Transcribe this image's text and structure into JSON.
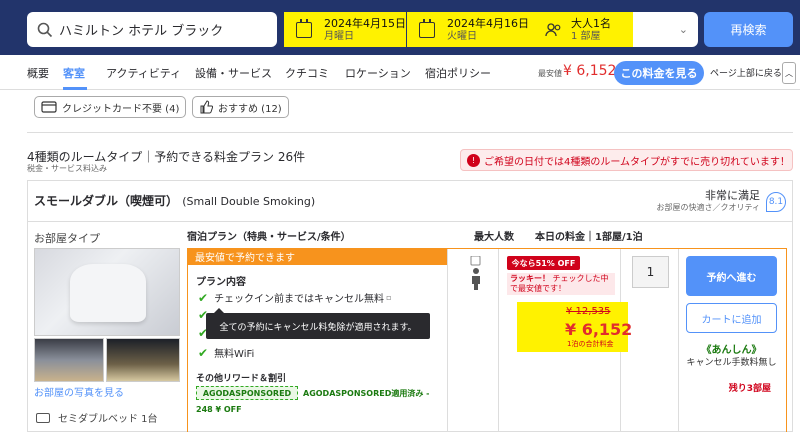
{
  "header": {
    "search_value": "ハミルトン ホテル ブラック",
    "checkin_date": "2024年4月15日",
    "checkin_day": "月曜日",
    "checkout_date": "2024年4月16日",
    "checkout_day": "火曜日",
    "guests": "大人1名",
    "rooms": "1 部屋",
    "research_label": "再検索"
  },
  "nav": {
    "tabs": [
      "概要",
      "客室",
      "アクティビティ",
      "設備・サービス",
      "クチコミ",
      "ロケーション",
      "宿泊ポリシー"
    ],
    "min_price_label": "最安値",
    "min_price": "¥ 6,152",
    "see_price_label": "この料金を見る",
    "to_top_label": "ページ上部に戻る"
  },
  "filters": {
    "chips": [
      "クレジットカード不要 (4)",
      "おすすめ (12)"
    ]
  },
  "room_summary": {
    "title": "4種類のルームタイプ｜予約できる料金プラン 26件",
    "tax_note": "税金・サービス料込み",
    "warning": "ご希望の日付では4種類のルームタイプがすでに売り切れています！"
  },
  "room": {
    "name": "スモールダブル（喫煙可）",
    "name_en": "(Small Double Smoking)",
    "satisfaction": "非常に満足",
    "satisfaction_sub": "お部屋の快適さ／クオリティ",
    "score": "8.1",
    "type_label": "お部屋タイプ",
    "photos_link": "お部屋の写真を見る",
    "bed": "セミダブルベッド 1台"
  },
  "columns": {
    "plan": "宿泊プラン（特典・サービス/条件）",
    "max_people": "最大人数",
    "price": "本日の料金｜1部屋/1泊"
  },
  "offer": {
    "banner": "最安値で予約できます",
    "plan_label": "プラン内容",
    "features": [
      "チェックイン前まではキャンセル無料",
      "",
      "",
      "無料WiFi"
    ],
    "tooltip": "全ての予約にキャンセル料免除が適用されます。",
    "rewards_label": "その他リワード＆割引",
    "coupon_code": "AGODASPONSORED",
    "coupon_applied": "AGODASPONSORED適用済み -",
    "coupon_amount": "248 ¥ OFF",
    "discount_badge": "今なら51% OFF",
    "lucky_title": "ラッキー！",
    "lucky_text": "チェックした中で最安値です！",
    "old_price": "¥ 12,535",
    "new_price": "¥ 6,152",
    "price_note": "1泊の合計料金",
    "quantity": "1",
    "book_label": "予約へ進む",
    "cart_label": "カートに追加",
    "anshin_title": "《あんしん》",
    "anshin_text": "キャンセル手数料無し",
    "rooms_left": "残り3部屋"
  },
  "colors": {
    "header_bg": "#22346b",
    "accent": "#5392f9",
    "highlight": "#fff200",
    "price_red": "#e12d2d",
    "offer_orange": "#f7931d"
  }
}
